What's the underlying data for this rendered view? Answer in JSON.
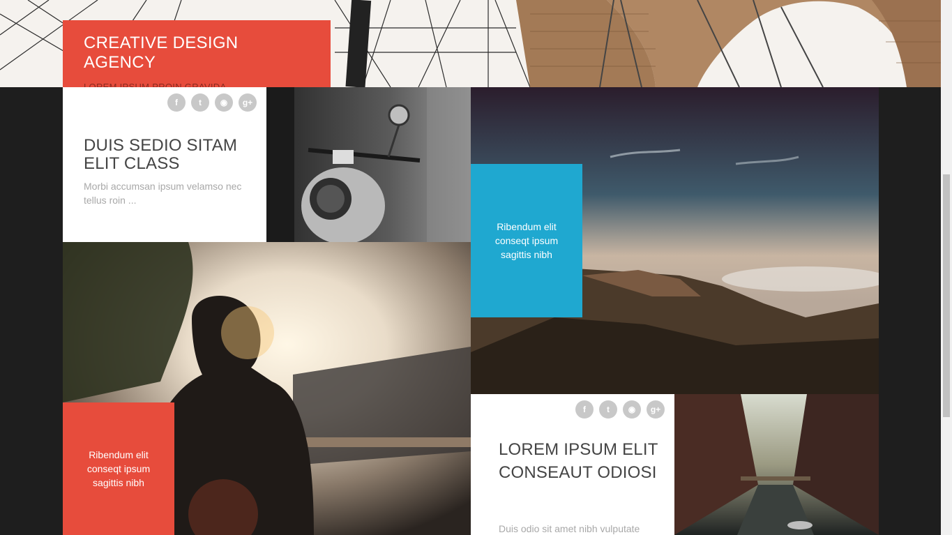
{
  "brand": {
    "title": "CREATIVE DESIGN AGENCY",
    "subtitle": "LOREM IPSUM PROIN GRAVIDA"
  },
  "social_icons": [
    {
      "name": "facebook-icon",
      "glyph": "f"
    },
    {
      "name": "twitter-icon",
      "glyph": "t"
    },
    {
      "name": "rss-icon",
      "glyph": "◉"
    },
    {
      "name": "google-plus-icon",
      "glyph": "g+"
    }
  ],
  "card1": {
    "title": "DUIS SEDIO SITAM ELIT CLASS",
    "text": "Morbi accumsan ipsum velamso nec tellus roin ..."
  },
  "blue_block": {
    "text": "Ribendum elit conseqt ipsum sagittis nibh"
  },
  "red_block": {
    "text": "Ribendum elit conseqt ipsum sagittis nibh"
  },
  "card2": {
    "title": "LOREM IPSUM ELIT CONSEAUT ODIOSI",
    "text": "Duis odio sit amet nibh vulputate"
  },
  "colors": {
    "accent_red": "#e74c3c",
    "accent_blue": "#1fa8d0",
    "background": "#1e1e1e"
  }
}
